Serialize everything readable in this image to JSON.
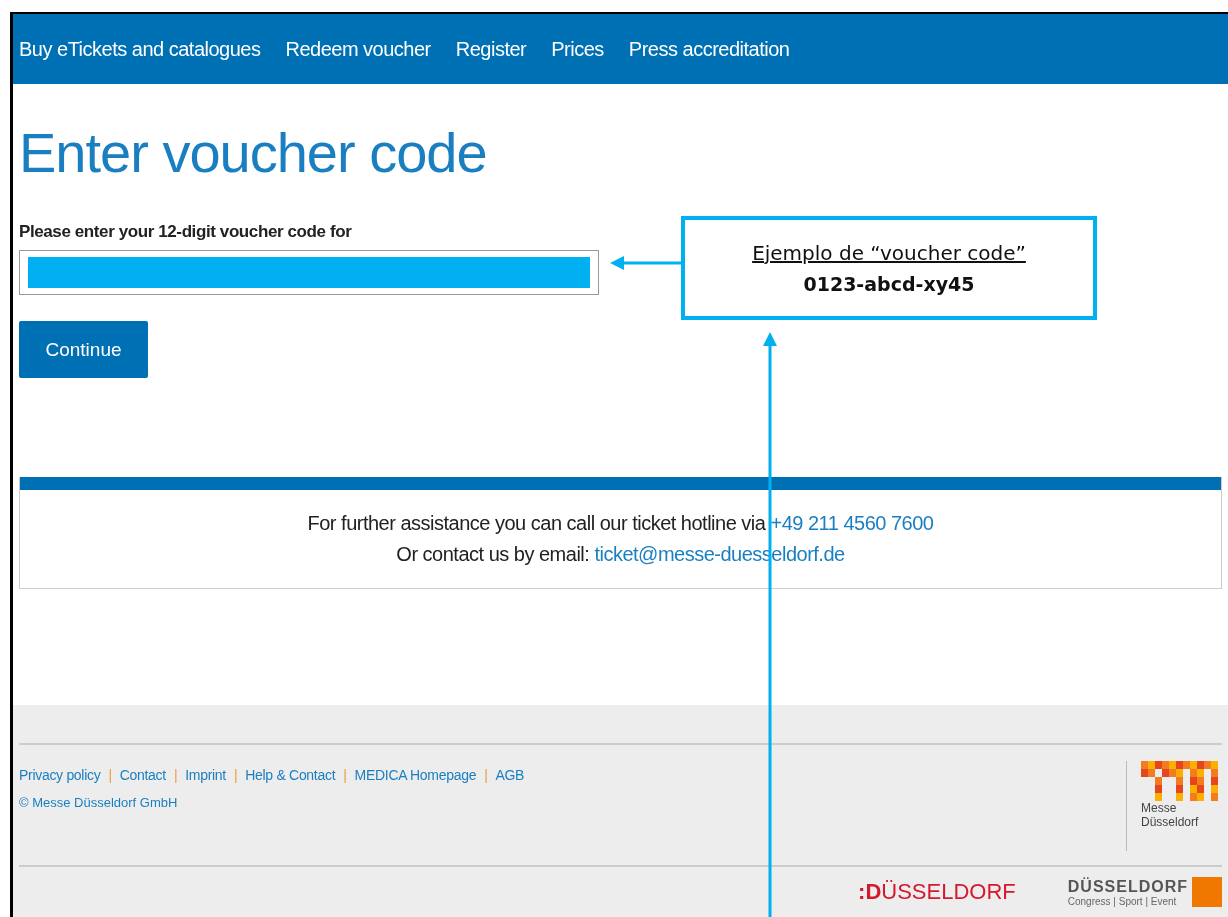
{
  "nav": {
    "items": [
      {
        "label": "Buy eTickets and catalogues"
      },
      {
        "label": "Redeem voucher"
      },
      {
        "label": "Register"
      },
      {
        "label": "Prices"
      },
      {
        "label": "Press accreditation"
      }
    ]
  },
  "heading": "Enter voucher code",
  "form": {
    "label": "Please enter your 12-digit voucher code for",
    "button": "Continue"
  },
  "annotation": {
    "title": "Ejemplo de “voucher code”",
    "example": "0123-abcd-xy45"
  },
  "help": {
    "line_1": "For further assistance you can call our ticket hotline via",
    "phone": "+49 211 4560 7600",
    "line_2": "Or contact us by email:",
    "email": "ticket@messe-duesseldorf.de"
  },
  "footer": {
    "links": [
      {
        "label": "Privacy policy",
        "separator": "|"
      },
      {
        "label": "Contact",
        "separator": "|"
      },
      {
        "label": "Imprint",
        "separator": "|"
      },
      {
        "label": "Help & Contact",
        "separator": "|"
      },
      {
        "label": "MEDICA Homepage",
        "separator": "|"
      },
      {
        "label": "AGB"
      }
    ],
    "copyright": "© Messe Düsseldorf GmbH",
    "logo_text": [
      "Messe",
      "Düsseldorf"
    ],
    "city_logo": "**:D**ÜSSELDORF",
    "congress_logo": {
      "title": "DÜSSELDORF",
      "subtitle": "Congress | Sport | Event"
    }
  }
}
